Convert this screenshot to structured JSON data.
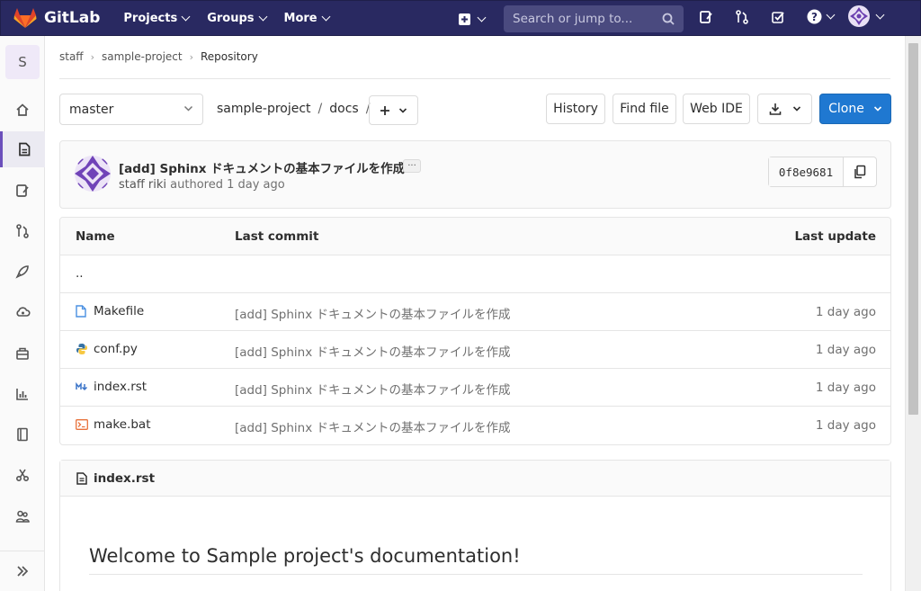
{
  "navbar": {
    "brand": "GitLab",
    "menu": [
      {
        "label": "Projects"
      },
      {
        "label": "Groups"
      },
      {
        "label": "More"
      }
    ],
    "search_placeholder": "Search or jump to..."
  },
  "sidebar": {
    "project_initial": "S",
    "items": [
      {
        "icon": "home-icon"
      },
      {
        "icon": "repository-icon",
        "active": true
      },
      {
        "icon": "issues-icon"
      },
      {
        "icon": "merge-request-icon"
      },
      {
        "icon": "rocket-icon"
      },
      {
        "icon": "operations-icon"
      },
      {
        "icon": "package-icon"
      },
      {
        "icon": "analytics-icon"
      },
      {
        "icon": "wiki-icon"
      },
      {
        "icon": "snippets-icon"
      },
      {
        "icon": "members-icon"
      }
    ]
  },
  "breadcrumb": {
    "items": [
      "staff",
      "sample-project"
    ],
    "current": "Repository"
  },
  "toolbar": {
    "branch": "master",
    "path": [
      "sample-project",
      "docs"
    ],
    "history": "History",
    "find_file": "Find file",
    "web_ide": "Web IDE",
    "clone": "Clone"
  },
  "commit": {
    "title": "[add] Sphinx ドキュメントの基本ファイルを作成",
    "author": "staff riki",
    "meta": "authored 1 day ago",
    "sha": "0f8e9681",
    "ellipsis": "..."
  },
  "tree": {
    "headers": {
      "name": "Name",
      "last_commit": "Last commit",
      "last_update": "Last update"
    },
    "parent": "..",
    "rows": [
      {
        "name": "Makefile",
        "icon": "file-icon",
        "commit": "[add] Sphinx ドキュメントの基本ファイルを作成",
        "updated": "1 day ago"
      },
      {
        "name": "conf.py",
        "icon": "python-icon",
        "commit": "[add] Sphinx ドキュメントの基本ファイルを作成",
        "updated": "1 day ago"
      },
      {
        "name": "index.rst",
        "icon": "markdown-icon",
        "commit": "[add] Sphinx ドキュメントの基本ファイルを作成",
        "updated": "1 day ago"
      },
      {
        "name": "make.bat",
        "icon": "terminal-icon",
        "commit": "[add] Sphinx ドキュメントの基本ファイルを作成",
        "updated": "1 day ago"
      }
    ]
  },
  "readme": {
    "filename": "index.rst",
    "heading": "Welcome to Sample project's documentation!"
  },
  "colors": {
    "navbar": "#292961",
    "accent": "#1f78d1",
    "sidebar_active": "#6b4fbb"
  }
}
